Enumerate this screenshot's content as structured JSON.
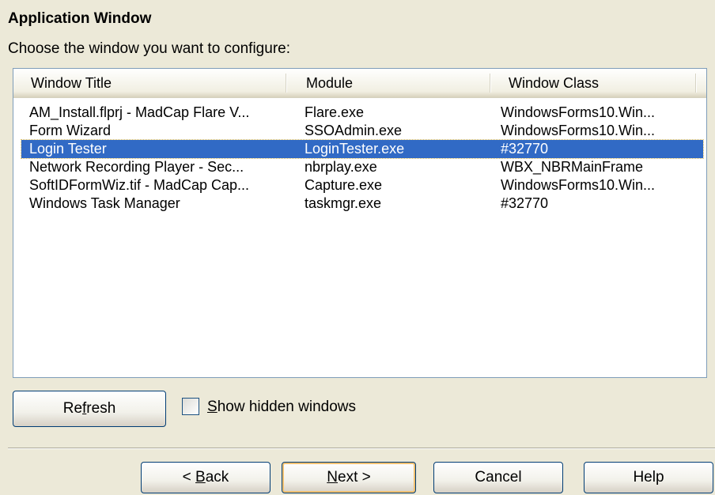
{
  "dialog": {
    "title": "Application Window",
    "subtitle": "Choose the window you want to configure:"
  },
  "list": {
    "columns": [
      "Window Title",
      "Module",
      "Window Class"
    ],
    "rows": [
      {
        "title": "AM_Install.flprj - MadCap Flare V...",
        "module": "Flare.exe",
        "class": "WindowsForms10.Win...",
        "selected": false
      },
      {
        "title": "Form Wizard",
        "module": "SSOAdmin.exe",
        "class": "WindowsForms10.Win...",
        "selected": false
      },
      {
        "title": "Login Tester",
        "module": "LoginTester.exe",
        "class": "#32770",
        "selected": true
      },
      {
        "title": "Network Recording Player - Sec...",
        "module": "nbrplay.exe",
        "class": "WBX_NBRMainFrame",
        "selected": false
      },
      {
        "title": "SoftIDFormWiz.tif - MadCap Cap...",
        "module": "Capture.exe",
        "class": "WindowsForms10.Win...",
        "selected": false
      },
      {
        "title": "Windows Task Manager",
        "module": "taskmgr.exe",
        "class": "#32770",
        "selected": false
      }
    ]
  },
  "controls": {
    "refresh_pre": "Re",
    "refresh_key": "f",
    "refresh_post": "resh",
    "show_hidden_key": "S",
    "show_hidden_rest": "how hidden windows",
    "show_hidden_checked": false
  },
  "nav": {
    "back_pre": "< ",
    "back_key": "B",
    "back_post": "ack",
    "next_key": "N",
    "next_post": "ext >",
    "cancel": "Cancel",
    "help": "Help"
  },
  "colors": {
    "selection": "#316ac5",
    "dialog_bg": "#ece9d8"
  }
}
